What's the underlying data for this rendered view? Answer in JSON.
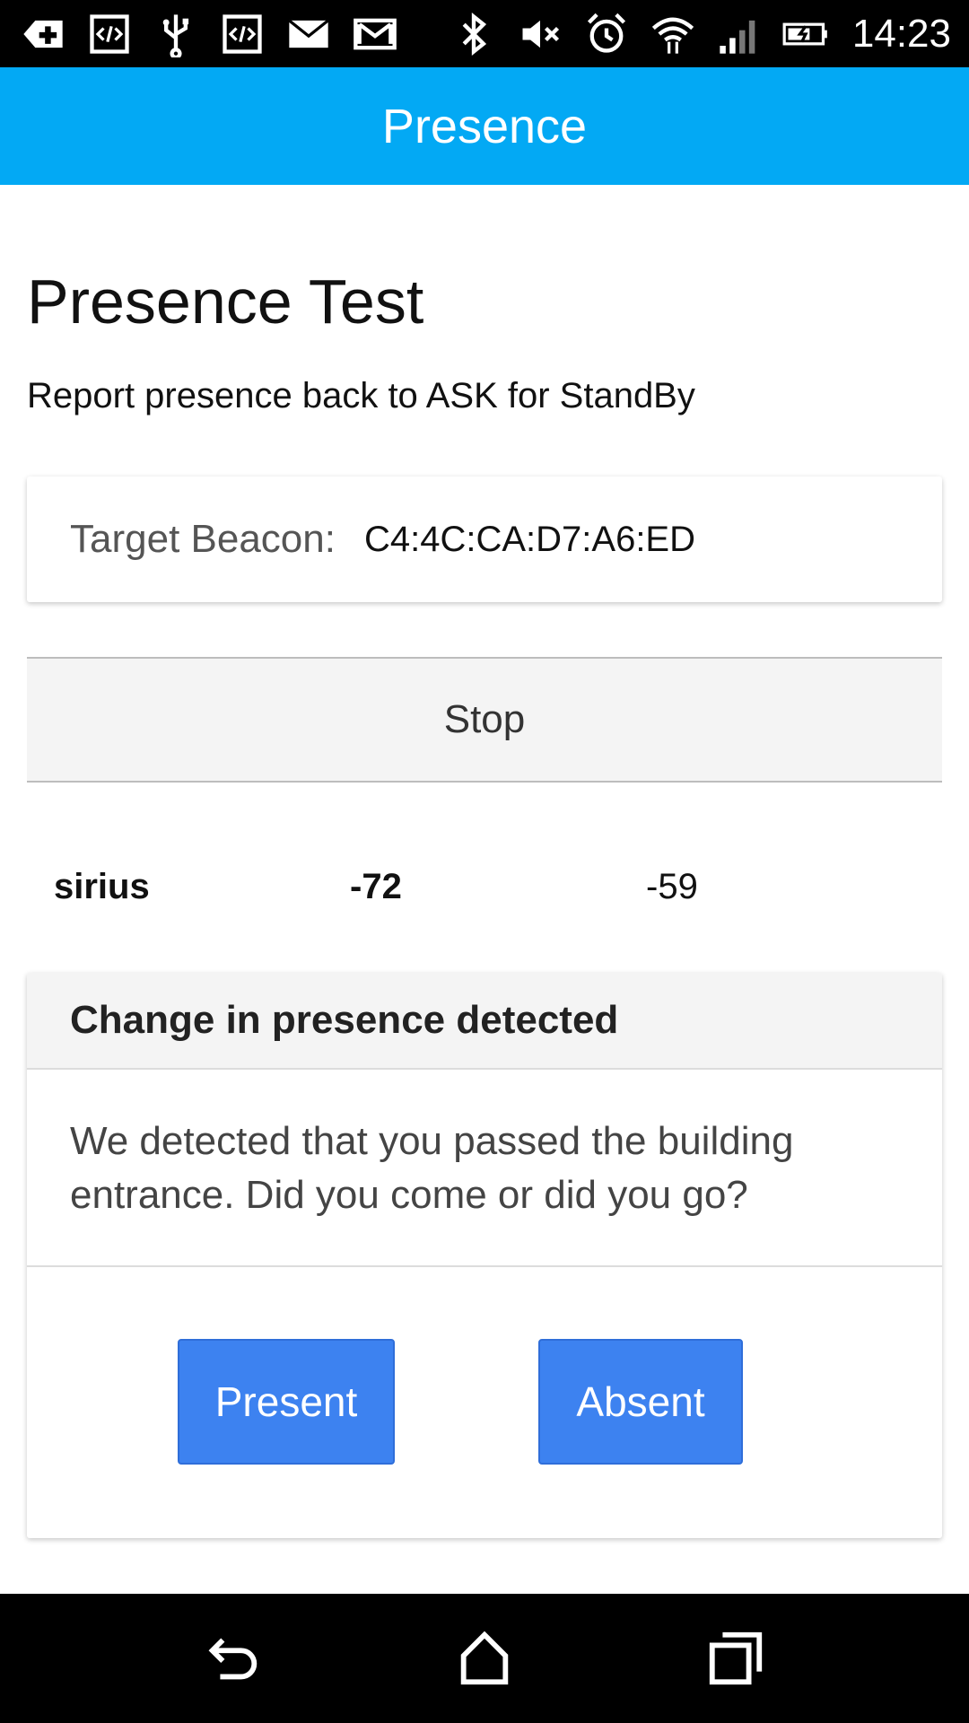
{
  "status_bar": {
    "time": "14:23",
    "icons_left": [
      "add-icon",
      "code-icon",
      "usb-icon",
      "code-icon",
      "mail-icon",
      "gmail-icon"
    ],
    "icons_right": [
      "bluetooth-icon",
      "muted-icon",
      "alarm-icon",
      "wifi-icon",
      "signal-icon",
      "battery-charging-icon"
    ]
  },
  "app_bar": {
    "title": "Presence"
  },
  "page": {
    "title": "Presence Test",
    "subtitle": "Report presence back to ASK for StandBy"
  },
  "beacon": {
    "label": "Target Beacon:",
    "value": "C4:4C:CA:D7:A6:ED"
  },
  "stop_button": {
    "label": "Stop"
  },
  "reading": {
    "name": "sirius",
    "rssi": "-72",
    "reference": "-59"
  },
  "dialog": {
    "title": "Change in presence detected",
    "message": "We detected that you passed the building entrance. Did you come or did you go?",
    "present_label": "Present",
    "absent_label": "Absent"
  },
  "nav_bar": {
    "icons": [
      "back-icon",
      "home-icon",
      "recents-icon"
    ]
  },
  "colors": {
    "app_bar": "#03a9f4",
    "button": "#3d82f0",
    "status_bar": "#000000"
  }
}
